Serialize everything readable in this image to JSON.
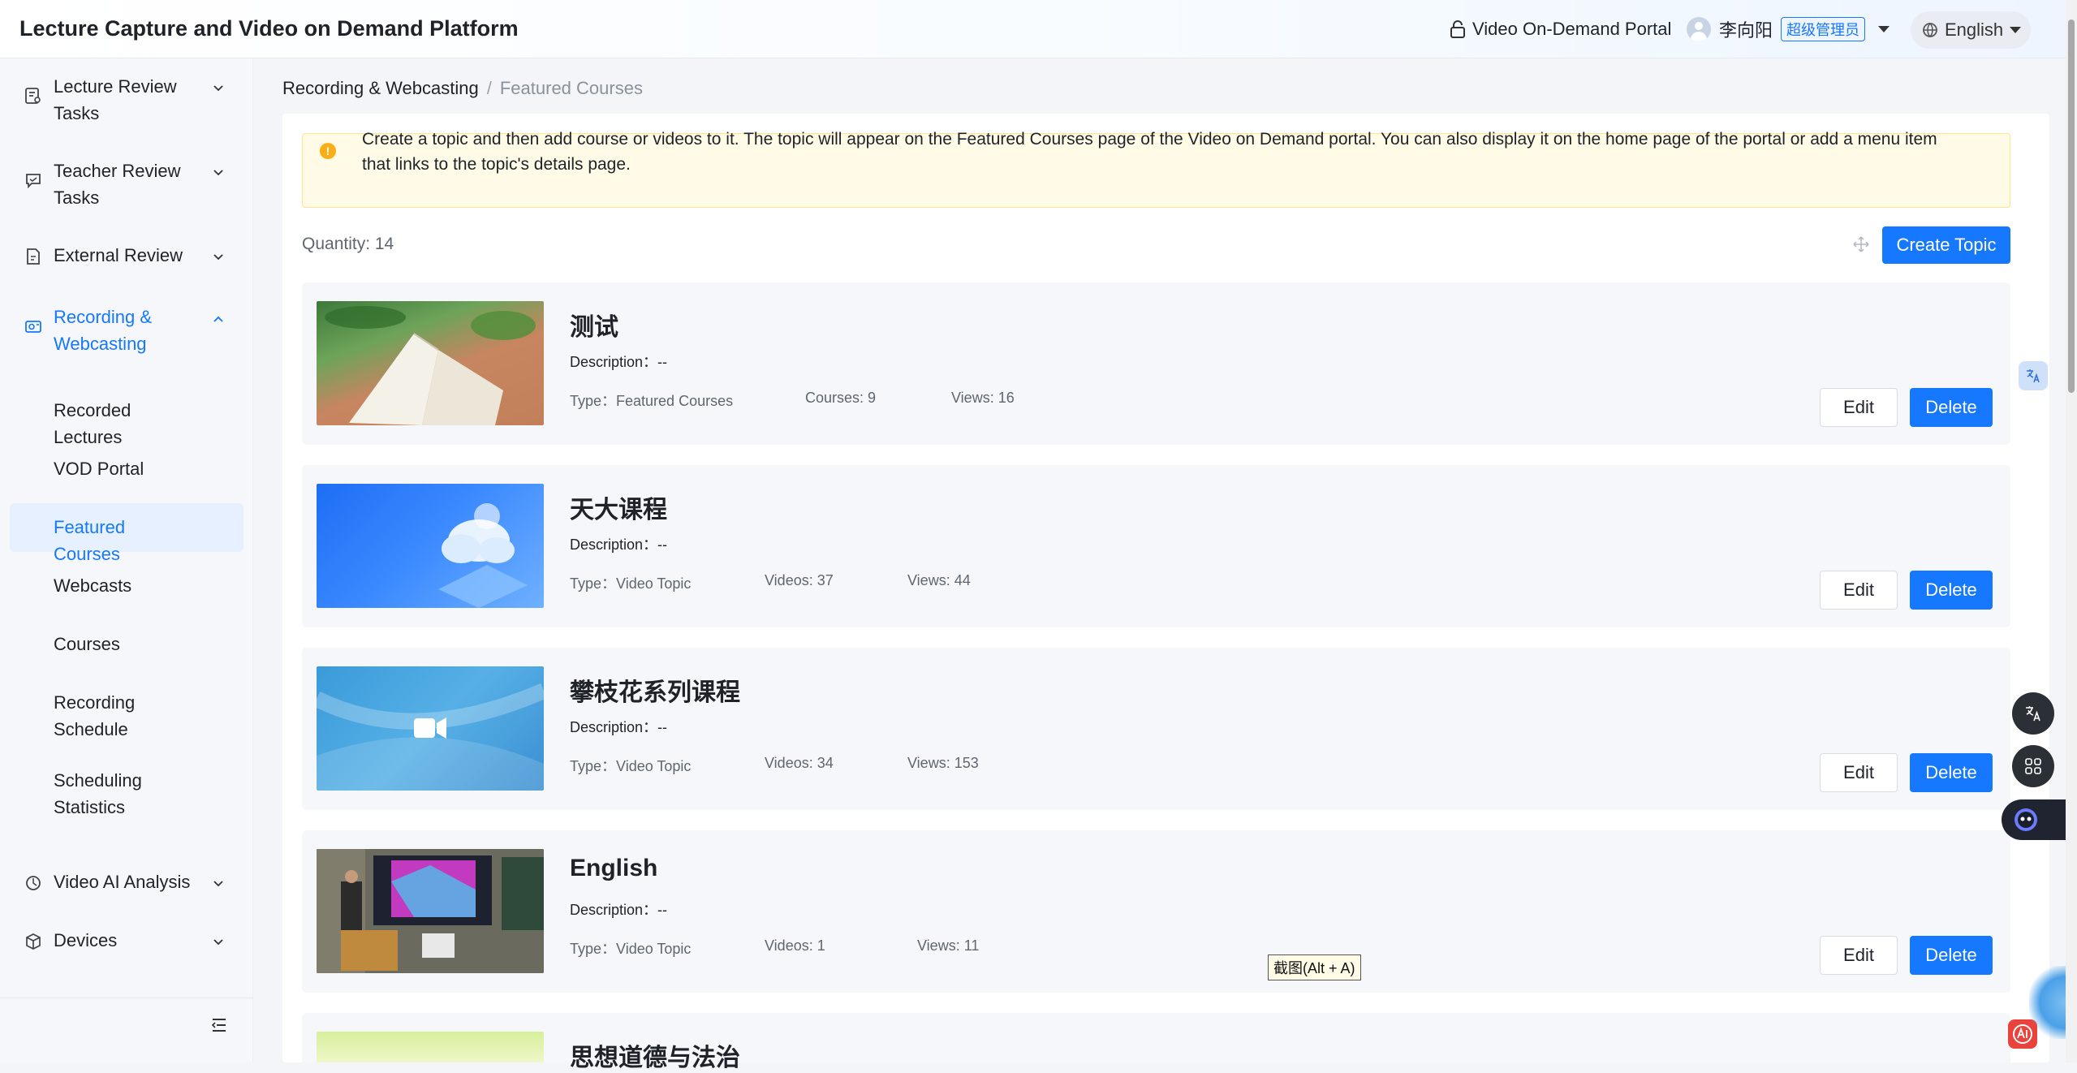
{
  "header": {
    "app_title": "Lecture Capture and Video on Demand Platform",
    "vod_portal_label": "Video On-Demand Portal",
    "user_name": "李向阳",
    "user_role": "超级管理员",
    "language": "English"
  },
  "sidebar": {
    "items": [
      {
        "label": "Lecture Review Tasks",
        "icon": "review-task-icon",
        "expanded": false
      },
      {
        "label": "Teacher Review Tasks",
        "icon": "chat-review-icon",
        "expanded": false
      },
      {
        "label": "External Review",
        "icon": "document-icon",
        "expanded": false
      },
      {
        "label": "Recording & Webcasting",
        "icon": "camera-icon",
        "expanded": true
      },
      {
        "label": "Video AI Analysis",
        "icon": "ai-analysis-icon",
        "expanded": false
      },
      {
        "label": "Devices",
        "icon": "cube-icon",
        "expanded": false
      }
    ],
    "sub_items": [
      {
        "label": "Recorded Lectures"
      },
      {
        "label": "VOD Portal"
      },
      {
        "label": "Featured Courses",
        "selected": true
      },
      {
        "label": "Webcasts"
      },
      {
        "label": "Courses"
      },
      {
        "label": "Recording Schedule"
      },
      {
        "label": "Scheduling Statistics"
      }
    ]
  },
  "breadcrumb": {
    "parent": "Recording & Webcasting",
    "separator": "/",
    "current": "Featured Courses"
  },
  "notice": {
    "text": "Create a topic and then add course or videos to it. The topic will appear on the Featured Courses page of the Video on Demand portal. You can also display it on the home page of the portal or add a menu item that links to the topic's details page."
  },
  "toolbar": {
    "quantity": "Quantity: 14",
    "create_label": "Create Topic"
  },
  "topics": [
    {
      "title": "测试",
      "description": "Description：--",
      "type": "Type：Featured Courses",
      "count": "Courses: 9",
      "views": "Views: 16"
    },
    {
      "title": "天大课程",
      "description": "Description：--",
      "type": "Type：Video Topic",
      "count": "Videos: 37",
      "views": "Views: 44"
    },
    {
      "title": "攀枝花系列课程",
      "description": "Description：--",
      "type": "Type：Video Topic",
      "count": "Videos: 34",
      "views": "Views: 153"
    },
    {
      "title": "English",
      "description": "Description：--",
      "type": "Type：Video Topic",
      "count": "Videos: 1",
      "views": "Views: 11"
    },
    {
      "title": "思想道德与法治"
    }
  ],
  "actions": {
    "edit_label": "Edit",
    "delete_label": "Delete"
  },
  "tooltip": "截图(Alt + A)",
  "colors": {
    "primary": "#1677ff",
    "notice_bg": "#fffbe6",
    "notice_icon": "#faad14"
  }
}
